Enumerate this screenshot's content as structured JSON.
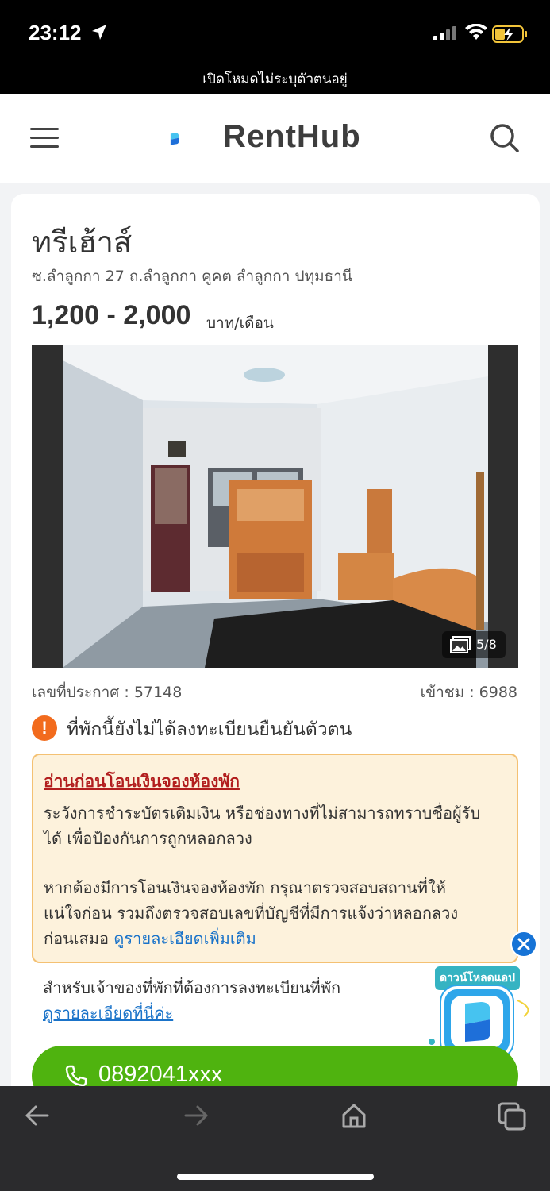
{
  "status_bar": {
    "time": "23:12",
    "private_mode_text": "เปิดโหมดไม่ระบุตัวตนอยู่"
  },
  "app_bar": {
    "brand": "RentHub",
    "menu_icon": "hamburger-menu-icon",
    "search_icon": "search-icon",
    "brand_color": "#1e88e5"
  },
  "listing": {
    "title": "ทรีเฮ้าส์",
    "address": "ซ.ลำลูกกา 27 ถ.ลำลูกกา คูคต ลำลูกกา ปทุมธานี",
    "price_range": "1,200 - 2,000",
    "price_unit": "บาท/เดือน",
    "photo_counter": "5/8",
    "announcement_label": "เลขที่ประกาศ : 57148",
    "views_label": "เข้าชม : 6988",
    "verification_warning": "ที่พักนี้ยังไม่ได้ลงทะเบียนยืนยันตัวตน"
  },
  "notice": {
    "title": "อ่านก่อนโอนเงินจองห้องพัก",
    "paragraph1_line1": "ระวังการชำระบัตรเติมเงิน หรือช่องทางที่ไม่สามารถทราบชื่อผู้รับ",
    "paragraph1_line2": "ได้ เพื่อป้องกันการถูกหลอกลวง",
    "paragraph2_line1": "หากต้องมีการโอนเงินจองห้องพัก กรุณาตรวจสอบสถานที่ให้",
    "paragraph2_line2": "แน่ใจก่อน รวมถึงตรวจสอบเลขที่บัญชีที่มีการแจ้งว่าหลอกลวง",
    "paragraph2_line3_prefix": "ก่อนเสมอ ",
    "more_link": "ดูรายละเอียดเพิ่มเติม",
    "bg_color": "#fdf2dc",
    "border_color": "#f4c173",
    "title_color": "#b21e1e"
  },
  "owner": {
    "text": "สำหรับเจ้าของที่พักที่ต้องการลงทะเบียนที่พัก",
    "link": "ดูรายละเอียดที่นี่ค่ะ"
  },
  "download_promo": {
    "badge": "ดาวน์โหลดแอป",
    "close_icon": "close-icon"
  },
  "call": {
    "phone": "0892041xxx",
    "button_color": "#4fb30f"
  },
  "browser_toolbar": {
    "icons": [
      "back-arrow-icon",
      "forward-arrow-icon",
      "home-icon",
      "tabs-icon"
    ]
  }
}
